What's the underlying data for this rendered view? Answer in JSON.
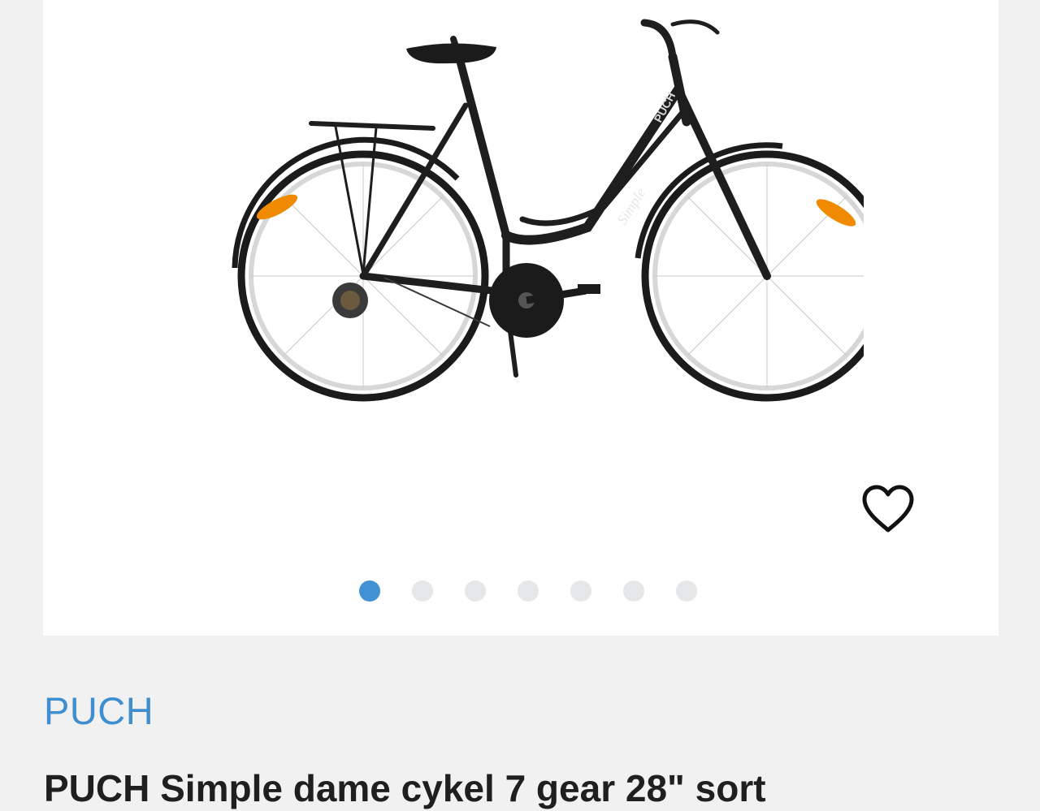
{
  "gallery": {
    "image_label": "PUCH Simple bicycle",
    "frame_text": "PUCH",
    "model_text": "Simple",
    "slide_count": 7,
    "active_index": 0
  },
  "favorite": {
    "icon": "heart-outline-icon"
  },
  "product": {
    "brand": "PUCH",
    "title": "PUCH Simple dame cykel 7 gear 28\" sort"
  },
  "colors": {
    "accent": "#3f8fd0",
    "dot_active": "#4291d3",
    "dot_inactive": "#e6e7e9",
    "background": "#f1f1f2"
  }
}
